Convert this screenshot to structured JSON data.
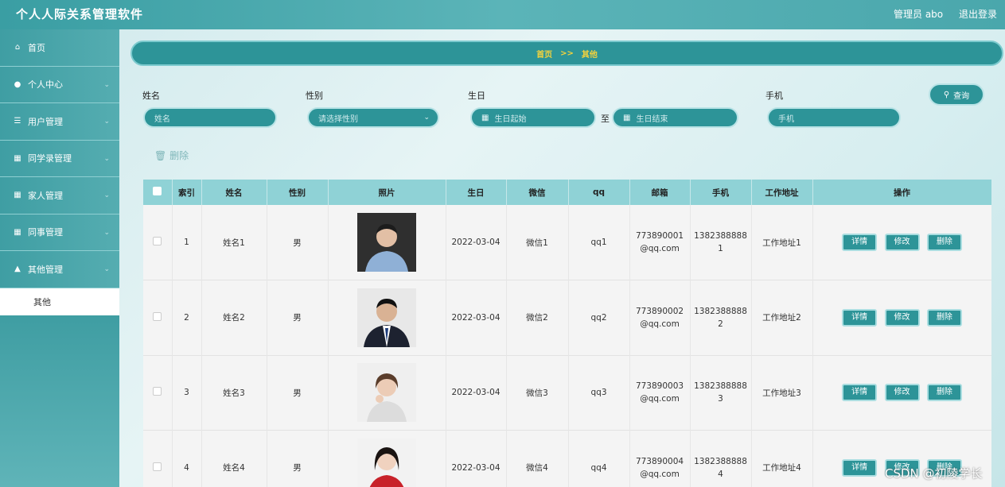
{
  "header": {
    "title": "个人人际关系管理软件",
    "admin": "管理员 abo",
    "logout": "退出登录"
  },
  "sidebar": {
    "items": [
      {
        "label": "首页",
        "icon": "home-icon",
        "expandable": false
      },
      {
        "label": "个人中心",
        "icon": "user-icon",
        "expandable": true
      },
      {
        "label": "用户管理",
        "icon": "list-icon",
        "expandable": true
      },
      {
        "label": "同学录管理",
        "icon": "grid-icon",
        "expandable": true
      },
      {
        "label": "家人管理",
        "icon": "grid-icon",
        "expandable": true
      },
      {
        "label": "同事管理",
        "icon": "grid-icon",
        "expandable": true
      },
      {
        "label": "其他管理",
        "icon": "thumb-icon",
        "expandable": true
      }
    ],
    "submenu": [
      {
        "label": "其他"
      }
    ]
  },
  "breadcrumb": {
    "home": "首页",
    "sep": ">>",
    "current": "其他"
  },
  "filters": {
    "name": {
      "label": "姓名",
      "placeholder": "姓名"
    },
    "gender": {
      "label": "性别",
      "placeholder": "请选择性别"
    },
    "birthday": {
      "label": "生日",
      "start_placeholder": "生日起始",
      "to": "至",
      "end_placeholder": "生日结束"
    },
    "phone": {
      "label": "手机",
      "placeholder": "手机"
    },
    "query_label": "查询",
    "delete_label": "删除"
  },
  "table": {
    "headers": [
      "索引",
      "姓名",
      "性别",
      "照片",
      "生日",
      "微信",
      "qq",
      "邮箱",
      "手机",
      "工作地址",
      "操作"
    ],
    "actions": {
      "detail": "详情",
      "edit": "修改",
      "delete": "删除"
    },
    "rows": [
      {
        "index": "1",
        "name": "姓名1",
        "gender": "男",
        "birthday": "2022-03-04",
        "wechat": "微信1",
        "qq": "qq1",
        "email_a": "773890001",
        "email_b": "@qq.com",
        "phone_a": "1382388888",
        "phone_b": "1",
        "address": "工作地址1"
      },
      {
        "index": "2",
        "name": "姓名2",
        "gender": "男",
        "birthday": "2022-03-04",
        "wechat": "微信2",
        "qq": "qq2",
        "email_a": "773890002",
        "email_b": "@qq.com",
        "phone_a": "1382388888",
        "phone_b": "2",
        "address": "工作地址2"
      },
      {
        "index": "3",
        "name": "姓名3",
        "gender": "男",
        "birthday": "2022-03-04",
        "wechat": "微信3",
        "qq": "qq3",
        "email_a": "773890003",
        "email_b": "@qq.com",
        "phone_a": "1382388888",
        "phone_b": "3",
        "address": "工作地址3"
      },
      {
        "index": "4",
        "name": "姓名4",
        "gender": "男",
        "birthday": "2022-03-04",
        "wechat": "微信4",
        "qq": "qq4",
        "email_a": "773890004",
        "email_b": "@qq.com",
        "phone_a": "1382388888",
        "phone_b": "4",
        "address": "工作地址4"
      }
    ]
  },
  "watermark": "CSDN @初陵学长",
  "colors": {
    "accent": "#2d9498",
    "crumb_text": "#f5d33c",
    "header_row": "#8fd2d6"
  }
}
